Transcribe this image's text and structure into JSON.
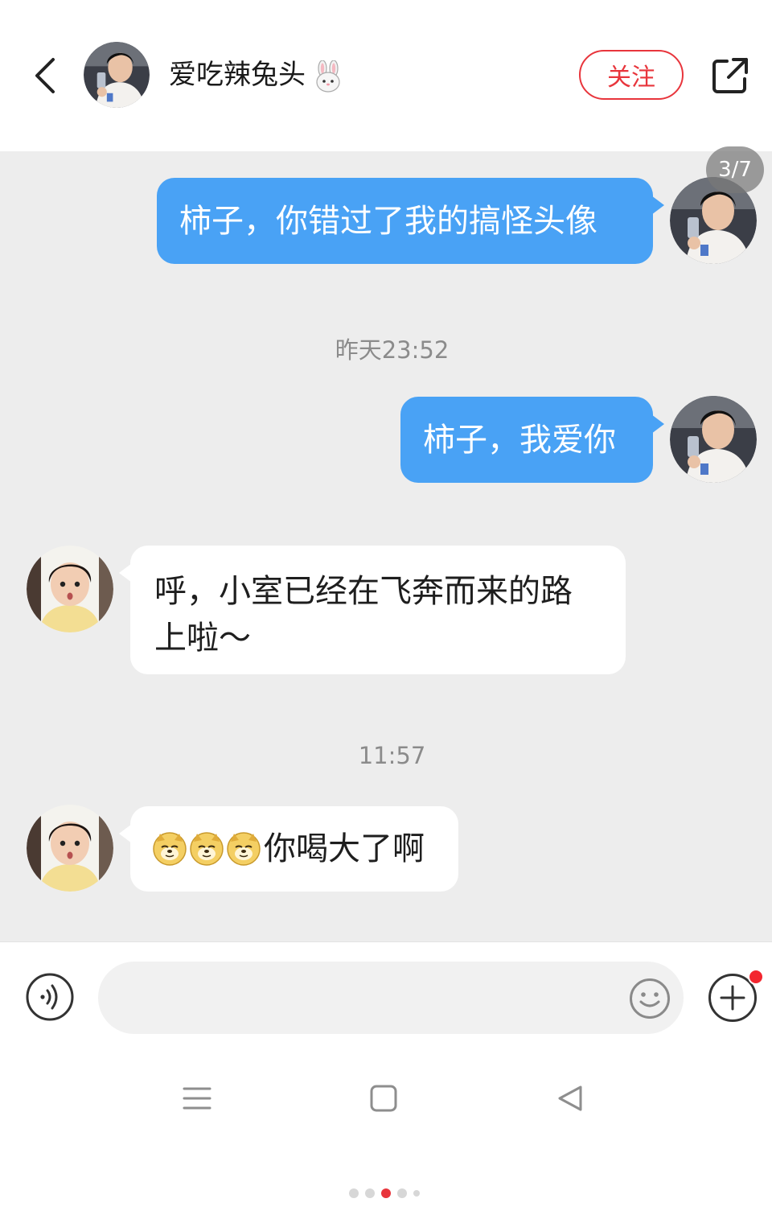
{
  "header": {
    "back_icon": "chevron-left-icon",
    "username": "爱吃辣兔头",
    "username_emoji": "rabbit-face",
    "follow_label": "关注",
    "share_icon": "share-external-icon"
  },
  "image_counter": "3/7",
  "messages": [
    {
      "side": "out",
      "text": "柿子，你错过了我的搞怪头像"
    },
    {
      "type": "time",
      "text": "昨天23:52"
    },
    {
      "side": "out",
      "text": "柿子，我爱你"
    },
    {
      "side": "in",
      "text": "呼，小室已经在飞奔而来的路上啦～"
    },
    {
      "type": "time",
      "text": "11:57"
    },
    {
      "side": "in",
      "emoji_count": 3,
      "emoji_name": "doge-emoji",
      "text": "你喝大了啊"
    }
  ],
  "input": {
    "placeholder": "",
    "voice_icon": "voice-icon",
    "emoji_icon": "smiley-icon",
    "plus_icon": "plus-circle-icon",
    "has_notification_dot": true
  },
  "nav": {
    "menu_icon": "menu-icon",
    "home_icon": "square-home-icon",
    "back_icon": "triangle-back-icon"
  },
  "page_indicator": {
    "count": 5,
    "active_index": 2
  },
  "colors": {
    "accent_red": "#e8353c",
    "outgoing_bubble": "#49a2f5",
    "chat_background": "#ededed"
  }
}
